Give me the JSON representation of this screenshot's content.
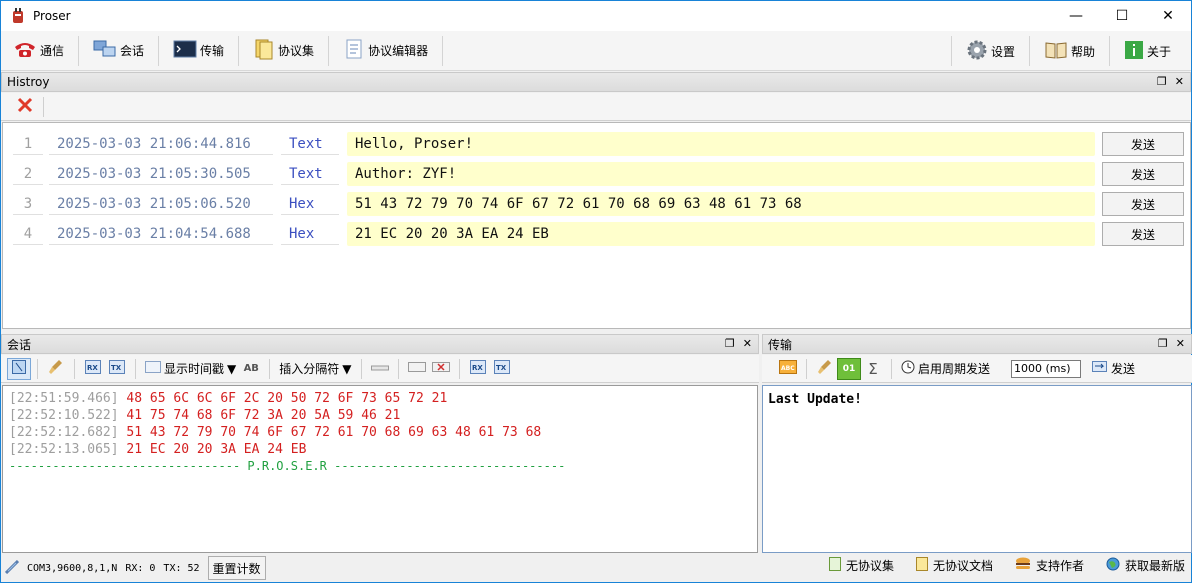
{
  "window": {
    "title": "Proser"
  },
  "toolbar": {
    "items": [
      {
        "label": "通信",
        "icon": "phone-icon"
      },
      {
        "label": "会话",
        "icon": "session-icon"
      },
      {
        "label": "传输",
        "icon": "terminal-icon"
      },
      {
        "label": "协议集",
        "icon": "protocol-set-icon"
      },
      {
        "label": "协议编辑器",
        "icon": "protocol-editor-icon"
      }
    ],
    "right_items": [
      {
        "label": "设置",
        "icon": "gear-icon"
      },
      {
        "label": "帮助",
        "icon": "book-icon"
      },
      {
        "label": "关于",
        "icon": "info-icon"
      }
    ]
  },
  "history": {
    "title": "Histroy",
    "send_label": "发送",
    "rows": [
      {
        "num": "1",
        "time": "2025-03-03 21:06:44.816",
        "type": "Text",
        "data": "Hello, Proser!"
      },
      {
        "num": "2",
        "time": "2025-03-03 21:05:30.505",
        "type": "Text",
        "data": "Author: ZYF!"
      },
      {
        "num": "3",
        "time": "2025-03-03 21:05:06.520",
        "type": "Hex",
        "data": "51 43 72 79 70 74 6F 67 72 61 70 68 69 63 48 61 73 68"
      },
      {
        "num": "4",
        "time": "2025-03-03 21:04:54.688",
        "type": "Hex",
        "data": "21 EC 20 20 3A EA 24 EB"
      }
    ]
  },
  "session": {
    "title": "会话",
    "show_timestamp_label": "显示时间戳",
    "insert_separator_label": "插入分隔符",
    "log": [
      {
        "ts": "[22:51:59.466]",
        "data": "48 65 6C 6C 6F 2C 20 50 72 6F 73 65 72 21"
      },
      {
        "ts": "[22:52:10.522]",
        "data": "41 75 74 68 6F 72 3A 20 5A 59 46 21"
      },
      {
        "ts": "[22:52:12.682]",
        "data": "51 43 72 79 70 74 6F 67 72 61 70 68 69 63 48 61 73 68"
      },
      {
        "ts": "[22:52:13.065]",
        "data": "21 EC 20 20 3A EA 24 EB"
      }
    ],
    "divider": "-------------------------------- P.R.O.S.E.R --------------------------------"
  },
  "transfer": {
    "title": "传输",
    "period_send_label": "启用周期发送",
    "period_value": "1000 (ms)",
    "send_label": "发送",
    "content": "Last Update!"
  },
  "status": {
    "port": "COM3,9600,8,1,N",
    "rx": "RX: 0",
    "tx": "TX: 52",
    "reset_label": "重置计数",
    "right": [
      {
        "label": "无协议集"
      },
      {
        "label": "无协议文档"
      },
      {
        "label": "支持作者"
      },
      {
        "label": "获取最新版"
      }
    ]
  }
}
